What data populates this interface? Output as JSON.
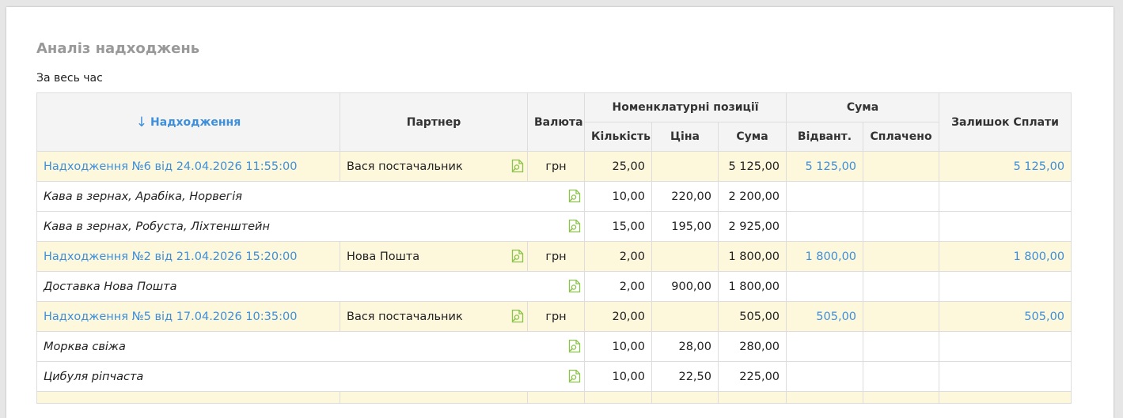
{
  "report": {
    "title": "Аналіз надходжень",
    "period": "За весь час"
  },
  "header": {
    "receipt": "Надходження",
    "partner": "Партнер",
    "currency": "Валюта",
    "positions_group": "Номенклатурні позиції",
    "qty": "Кількість",
    "price": "Ціна",
    "amount": "Сума",
    "sum_group": "Сума",
    "shipped": "Відвант.",
    "paid": "Сплачено",
    "balance": "Залишок Сплати"
  },
  "icons": {
    "sort": "arrow-down-icon",
    "document": "document-search-icon"
  },
  "colors": {
    "link": "#3d8fdb",
    "doc_row_bg": "#fdf7dc",
    "icon": "#8bc34a",
    "title": "#999999"
  },
  "rows": [
    {
      "type": "doc",
      "name": "Надходження №6 від 24.04.2026 11:55:00",
      "partner": "Вася постачальник",
      "currency": "грн",
      "qty": "25,00",
      "price": "",
      "amount": "5 125,00",
      "shipped": "5 125,00",
      "paid": "",
      "balance": "5 125,00"
    },
    {
      "type": "item",
      "name": "Кава в зернах, Арабіка, Норвегія",
      "qty": "10,00",
      "price": "220,00",
      "amount": "2 200,00"
    },
    {
      "type": "item",
      "name": "Кава в зернах, Робуста, Ліхтенштейн",
      "qty": "15,00",
      "price": "195,00",
      "amount": "2 925,00"
    },
    {
      "type": "doc",
      "name": "Надходження №2 від 21.04.2026 15:20:00",
      "partner": "Нова Пошта",
      "currency": "грн",
      "qty": "2,00",
      "price": "",
      "amount": "1 800,00",
      "shipped": "1 800,00",
      "paid": "",
      "balance": "1 800,00"
    },
    {
      "type": "item",
      "name": "Доставка Нова Пошта",
      "qty": "2,00",
      "price": "900,00",
      "amount": "1 800,00"
    },
    {
      "type": "doc",
      "name": "Надходження №5 від 17.04.2026 10:35:00",
      "partner": "Вася постачальник",
      "currency": "грн",
      "qty": "20,00",
      "price": "",
      "amount": "505,00",
      "shipped": "505,00",
      "paid": "",
      "balance": "505,00"
    },
    {
      "type": "item",
      "name": "Морква свіжа",
      "qty": "10,00",
      "price": "28,00",
      "amount": "280,00"
    },
    {
      "type": "item",
      "name": "Цибуля ріпчаста",
      "qty": "10,00",
      "price": "22,50",
      "amount": "225,00"
    }
  ]
}
